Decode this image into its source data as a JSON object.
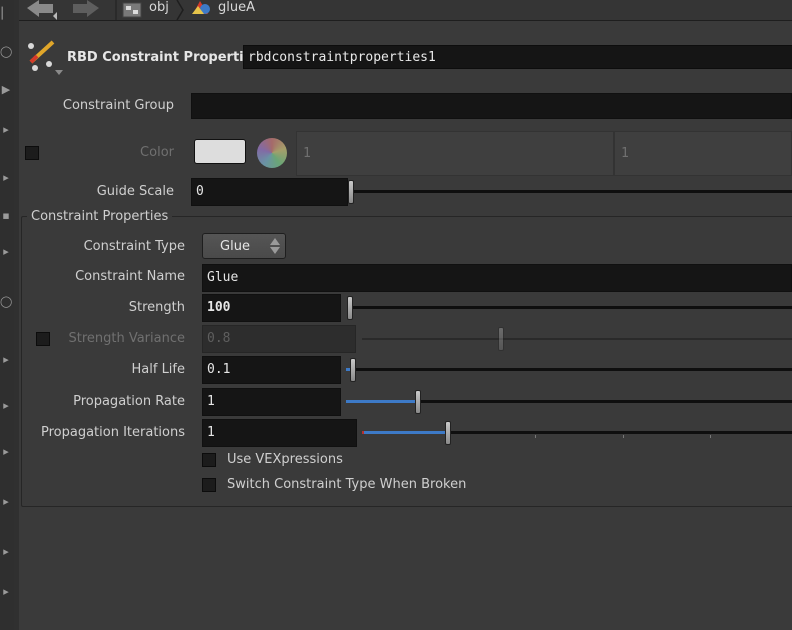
{
  "breadcrumb": {
    "obj_label": "obj",
    "node_label": "glueA"
  },
  "header": {
    "title": "RBD Constraint Properties",
    "node_name": "rbdconstraintproperties1"
  },
  "params": {
    "constraint_group": {
      "label": "Constraint Group",
      "value": ""
    },
    "color": {
      "label": "Color",
      "g": "1",
      "b": "1",
      "swatch": "#dddddd"
    },
    "guide_scale": {
      "label": "Guide Scale",
      "value": "0",
      "fraction": 0.0
    },
    "section_label": "Constraint Properties",
    "constraint_type": {
      "label": "Constraint Type",
      "value": "Glue"
    },
    "constraint_name": {
      "label": "Constraint Name",
      "value": "Glue"
    },
    "strength": {
      "label": "Strength",
      "value": "100"
    },
    "strength_variance": {
      "label": "Strength Variance",
      "value": "0.8"
    },
    "half_life": {
      "label": "Half Life",
      "value": "0.1"
    },
    "propagation_rate": {
      "label": "Propagation Rate",
      "value": "1"
    },
    "propagation_iterations": {
      "label": "Propagation Iterations",
      "value": "1"
    },
    "use_vex": {
      "label": "Use VEXpressions"
    },
    "switch_type": {
      "label": "Switch Constraint Type When Broken"
    }
  },
  "colors": {
    "accent_blue": "#3d7ac7",
    "accent_red": "#b83030"
  }
}
